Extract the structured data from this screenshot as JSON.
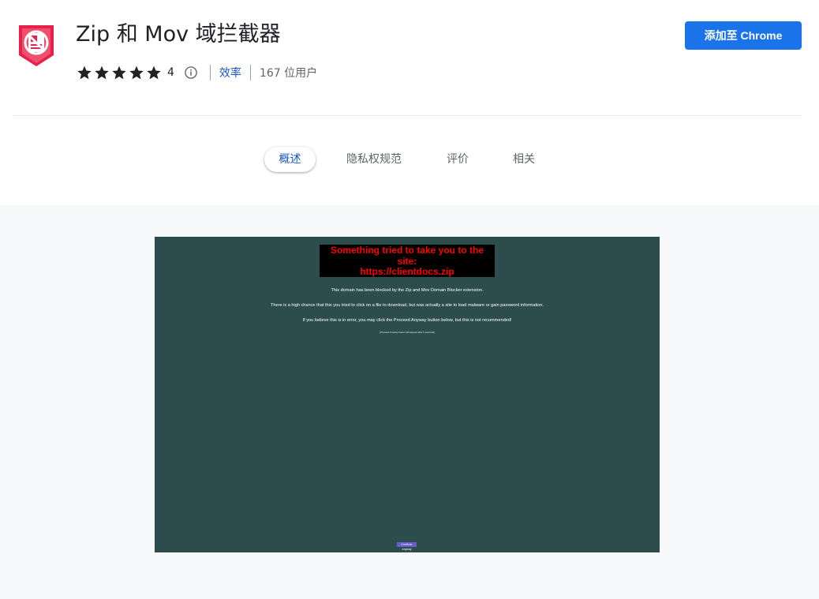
{
  "extension": {
    "icon": "blocked-file-shield-icon",
    "title": "Zip 和 Mov 域拦截器",
    "rating_stars": 5,
    "rating_count": "4",
    "category": "效率",
    "users": "167 位用户",
    "add_button_label": "添加至 Chrome"
  },
  "tabs": [
    {
      "label": "概述",
      "active": true
    },
    {
      "label": "隐私权规范",
      "active": false
    },
    {
      "label": "评价",
      "active": false
    },
    {
      "label": "相关",
      "active": false
    }
  ],
  "screenshot": {
    "heading_line1": "Something tried to take you to the site:",
    "heading_line2": "https://clientdocs.zip",
    "line1": "This domain has been blocked by the Zip and Mov Domain Blocker extension.",
    "line2": "There is a high chance that this you tried to click on a file to download, but was actually a site to load malware or gain password information.",
    "line3": "If you believe this is in error, you may click the Proceed Anyway button below, but this is not recommended!",
    "line4": "(Proceed Anyway button will appear after 5 seconds)",
    "continue_button": "Continue Anyway"
  },
  "colors": {
    "accent": "#1a73e8",
    "link": "#1a56c8",
    "screenshot_bg": "#2d4c4c",
    "warning_text": "#ff0000",
    "icon_red": "#e8204e"
  }
}
